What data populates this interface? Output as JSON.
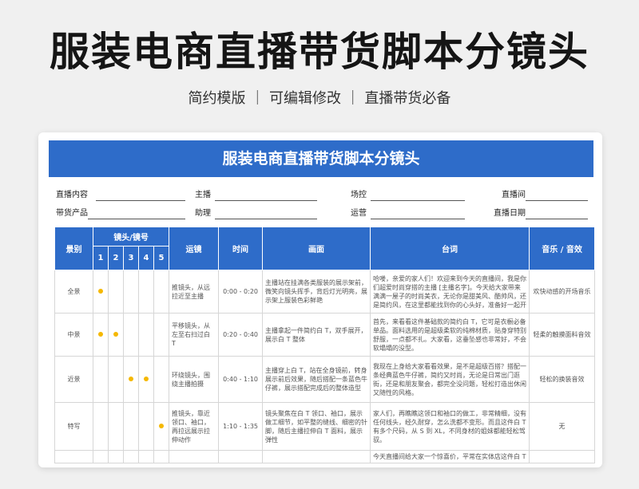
{
  "page": {
    "title": "服装电商直播带货脚本分镜头",
    "subtitle": "简约模版 ｜ 可编辑修改 ｜ 直播带货必备"
  },
  "sheet": {
    "title": "服装电商直播带货脚本分镜头",
    "info_row1": [
      "直播内容",
      "主播",
      "场控",
      "直播间"
    ],
    "info_row2": [
      "带货产品",
      "助理",
      "运营",
      "直播日期"
    ],
    "headers": {
      "category": "景别",
      "shot_group": "镜头/镜号",
      "shot_numbers": [
        "1",
        "2",
        "3",
        "4",
        "5"
      ],
      "movement": "运镜",
      "time": "时间",
      "frame": "画面",
      "lines": "台词",
      "music": "音乐 / 音效"
    },
    "rows": [
      {
        "category": "全景",
        "shots": [
          1
        ],
        "movement": "推镜头，从远拉近至主播",
        "time": "0:00 - 0:20",
        "frame": "主播站在挂满各类服装的展示架前，微笑向镜头挥手，背后灯光明亮，展示架上服装色彩鲜艳",
        "lines": "哈喽，亲爱的家人们！欢迎来到今天的直播间，我是你们超爱时尚穿搭的主播 [主播名字]。今天给大家带来满满一屋子的时尚美衣，无论你是甜美风、酷帅风，还是简约风，在这里都能找到你的心头好，准备好一起开启",
        "music": "欢快动感的开场音乐"
      },
      {
        "category": "中景",
        "shots": [
          1,
          2
        ],
        "movement": "平移镜头，从左至右扫过白 T",
        "time": "0:20 - 0:40",
        "frame": "主播拿起一件简约白 T，双手展开，展示白 T 整体",
        "lines": "首先，来看看这件基础款的简约白 T，它可是衣橱必备单品。面料选用的是超级柔软的纯棉材质，贴身穿特别舒服，一点都不扎。大家看，这垂坠感也非常好，不会软塌塌的没型。",
        "music": "轻柔的触摸面料音效"
      },
      {
        "category": "近景",
        "shots": [
          3,
          4
        ],
        "movement": "环绕镜头，围绕主播拍摄",
        "time": "0:40 - 1:10",
        "frame": "主播穿上白 T，站在全身镜前，转身展示前后效果，随后搭配一条蓝色牛仔裤，展示搭配完成后的整体造型",
        "lines": "我现在上身给大家看看效果，是不是超级百搭？搭配一条经典蓝色牛仔裤，简约又时尚，无论是日常出门逛街，还是和朋友聚会，都完全没问题，轻松打造出休闲又随性的风格。",
        "music": "轻松的换装音效"
      },
      {
        "category": "特写",
        "shots": [
          5
        ],
        "movement": "推镜头，靠近领口、袖口，再拉远展示拉伸动作",
        "time": "1:10 - 1:35",
        "frame": "镜头聚焦在白 T 领口、袖口，展示做工细节，如平整的缝线、细密的针脚，随后主播拉伸白 T 面料，展示弹性",
        "lines": "家人们，再瞧瞧这领口和袖口的做工，非常精细，没有任何线头，经久耐穿，怎么洗都不变形。而且这件白 T 有多个尺码，从 S 到 XL，不同身材的姐妹都能轻松驾驭。",
        "music": "无"
      },
      {
        "category": "",
        "shots": [],
        "movement": "",
        "time": "",
        "frame": "",
        "lines": "今天直播间给大家一个惊喜价，平常在实体店这件白 T",
        "music": ""
      }
    ]
  },
  "colors": {
    "header_blue": "#2e6cc9",
    "dot_yellow": "#f5b800"
  }
}
